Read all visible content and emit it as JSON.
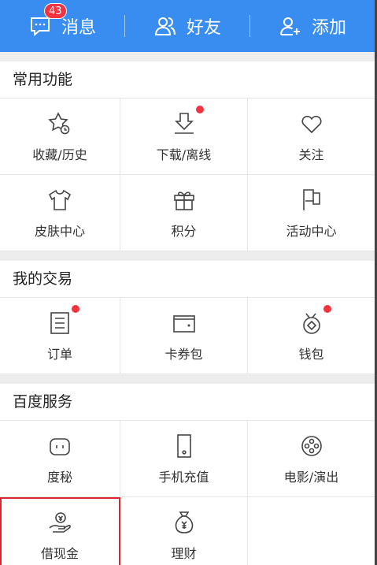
{
  "topbar": {
    "messages": {
      "label": "消息",
      "badge": "43",
      "icon": "chat-bubble-icon"
    },
    "friends": {
      "label": "好友",
      "icon": "people-icon"
    },
    "add": {
      "label": "添加",
      "icon": "add-person-icon"
    }
  },
  "common": {
    "title": "常用功能",
    "items": [
      {
        "label": "收藏/历史",
        "icon": "star-clock-icon"
      },
      {
        "label": "下载/离线",
        "icon": "download-icon"
      },
      {
        "label": "关注",
        "icon": "heart-icon"
      },
      {
        "label": "皮肤中心",
        "icon": "tshirt-icon"
      },
      {
        "label": "积分",
        "icon": "gift-icon"
      },
      {
        "label": "活动中心",
        "icon": "flag-icon"
      }
    ]
  },
  "trade": {
    "title": "我的交易",
    "items": [
      {
        "label": "订单",
        "icon": "order-list-icon"
      },
      {
        "label": "卡券包",
        "icon": "wallet-card-icon"
      },
      {
        "label": "钱包",
        "icon": "purse-icon"
      }
    ]
  },
  "services": {
    "title": "百度服务",
    "items": [
      {
        "label": "度秘",
        "icon": "assistant-icon"
      },
      {
        "label": "手机充值",
        "icon": "phone-icon"
      },
      {
        "label": "电影/演出",
        "icon": "film-reel-icon"
      },
      {
        "label": "借现金",
        "icon": "hand-coin-icon"
      },
      {
        "label": "理财",
        "icon": "money-bag-icon"
      }
    ]
  },
  "colors": {
    "topbar": "#3a8df0",
    "badge": "#f3333f",
    "highlight": "#d9282f"
  }
}
